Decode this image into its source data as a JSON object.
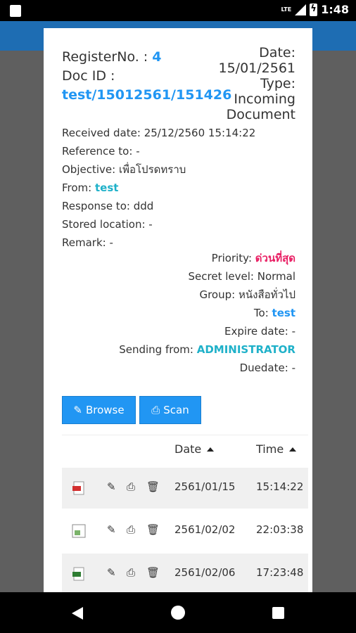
{
  "status": {
    "time": "1:48",
    "network": "LTE"
  },
  "header": {
    "register_label": "RegisterNo. :",
    "register_no": "4",
    "docid_label": "Doc ID :",
    "doc_id": "test/15012561/151426",
    "date_label": "Date:",
    "date_value": "15/01/2561",
    "type_label": "Type:",
    "type_value": "Incoming Document"
  },
  "info": {
    "received_label": "Received date:",
    "received_value": "25/12/2560 15:14:22",
    "reference_label": "Reference to:",
    "reference_value": "-",
    "objective_label": "Objective:",
    "objective_value": "เพื่อโปรดทราบ",
    "from_label": "From:",
    "from_value": "test",
    "response_label": "Response to:",
    "response_value": "ddd",
    "stored_label": "Stored location:",
    "stored_value": "-",
    "remark_label": "Remark:",
    "remark_value": "-"
  },
  "details": {
    "priority_label": "Priority:",
    "priority_value": "ด่วนที่สุด",
    "secret_label": "Secret level:",
    "secret_value": "Normal",
    "group_label": "Group:",
    "group_value": "หนังสือทั่วไป",
    "to_label": "To:",
    "to_value": "test",
    "expire_label": "Expire date:",
    "expire_value": "-",
    "sending_label": "Sending from:",
    "sending_value": "ADMINISTRATOR",
    "due_label": "Duedate:",
    "due_value": "-"
  },
  "buttons": {
    "browse": "Browse",
    "scan": "Scan"
  },
  "table": {
    "col_date": "Date",
    "col_time": "Time",
    "rows": [
      {
        "icon": "pdf-file-icon",
        "date": "2561/01/15",
        "time": "15:14:22"
      },
      {
        "icon": "image-file-icon",
        "date": "2561/02/02",
        "time": "22:03:38"
      },
      {
        "icon": "spreadsheet-file-icon",
        "date": "2561/02/06",
        "time": "17:23:48"
      }
    ]
  },
  "colors": {
    "accent": "#2196f3",
    "teal": "#1fb1c9",
    "priority": "#e91e63"
  }
}
